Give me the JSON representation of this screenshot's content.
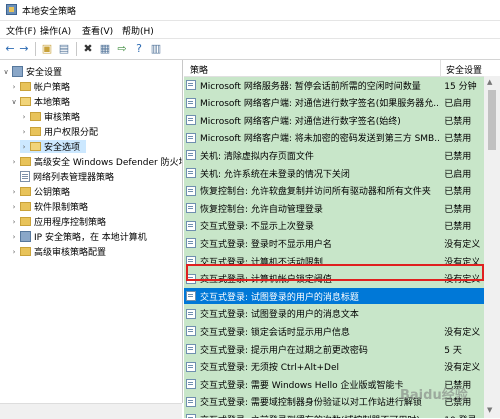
{
  "window": {
    "title": "本地安全策略"
  },
  "menu": [
    "文件(F)",
    "操作(A)",
    "查看(V)",
    "帮助(H)"
  ],
  "toolbar": {
    "icons": [
      "back-icon",
      "forward-icon",
      "folder-up-icon",
      "show-tree-icon",
      "delete-icon",
      "properties-icon",
      "refresh-icon",
      "export-icon",
      "help-icon",
      "console-icon"
    ]
  },
  "tree": [
    {
      "label": "安全设置",
      "type": "sec",
      "expanded": true
    },
    {
      "label": "帐户策略",
      "type": "folder"
    },
    {
      "label": "本地策略",
      "type": "folder",
      "expanded": true
    },
    {
      "label": "审核策略",
      "type": "folder"
    },
    {
      "label": "用户权限分配",
      "type": "folder"
    },
    {
      "label": "安全选项",
      "type": "folder",
      "selected": true
    },
    {
      "label": "高级安全 Windows Defender 防火墙",
      "type": "folder"
    },
    {
      "label": "网络列表管理器策略",
      "type": "doc"
    },
    {
      "label": "公钥策略",
      "type": "folder"
    },
    {
      "label": "软件限制策略",
      "type": "folder"
    },
    {
      "label": "应用程序控制策略",
      "type": "folder"
    },
    {
      "label": "IP 安全策略，在 本地计算机",
      "type": "sec"
    },
    {
      "label": "高级审核策略配置",
      "type": "folder"
    }
  ],
  "columns": {
    "policy": "策略",
    "setting": "安全设置"
  },
  "policies": [
    {
      "name": "Microsoft 网络服务器: 暂停会话前所需的空闲时间数量",
      "value": "15 分钟"
    },
    {
      "name": "Microsoft 网络客户端: 对通信进行数字签名(如果服务器允...",
      "value": "已启用"
    },
    {
      "name": "Microsoft 网络客户端: 对通信进行数字签名(始终)",
      "value": "已禁用"
    },
    {
      "name": "Microsoft 网络客户端: 将未加密的密码发送到第三方 SMB...",
      "value": "已禁用"
    },
    {
      "name": "关机: 清除虚拟内存页面文件",
      "value": "已禁用"
    },
    {
      "name": "关机: 允许系统在未登录的情况下关闭",
      "value": "已启用"
    },
    {
      "name": "恢复控制台: 允许软盘复制并访问所有驱动器和所有文件夹",
      "value": "已禁用"
    },
    {
      "name": "恢复控制台: 允许自动管理登录",
      "value": "已禁用"
    },
    {
      "name": "交互式登录: 不显示上次登录",
      "value": "已禁用"
    },
    {
      "name": "交互式登录: 登录时不显示用户名",
      "value": "没有定义"
    },
    {
      "name": "交互式登录: 计算机不活动限制",
      "value": "没有定义"
    },
    {
      "name": "交互式登录: 计算机帐户锁定阈值",
      "value": "没有定义"
    },
    {
      "name": "交互式登录: 试图登录的用户的消息标题",
      "value": "",
      "selected": true
    },
    {
      "name": "交互式登录: 试图登录的用户的消息文本",
      "value": ""
    },
    {
      "name": "交互式登录: 锁定会话时显示用户信息",
      "value": "没有定义"
    },
    {
      "name": "交互式登录: 提示用户在过期之前更改密码",
      "value": "5 天"
    },
    {
      "name": "交互式登录: 无须按 Ctrl+Alt+Del",
      "value": "没有定义"
    },
    {
      "name": "交互式登录: 需要 Windows Hello 企业版或智能卡",
      "value": "已禁用"
    },
    {
      "name": "交互式登录: 需要域控制器身份验证以对工作站进行解锁",
      "value": "已禁用"
    },
    {
      "name": "交互式登录: 之前登录到缓存的次数(域控制器不可用时)",
      "value": "10 登录"
    }
  ],
  "watermark": "Baidu经验"
}
